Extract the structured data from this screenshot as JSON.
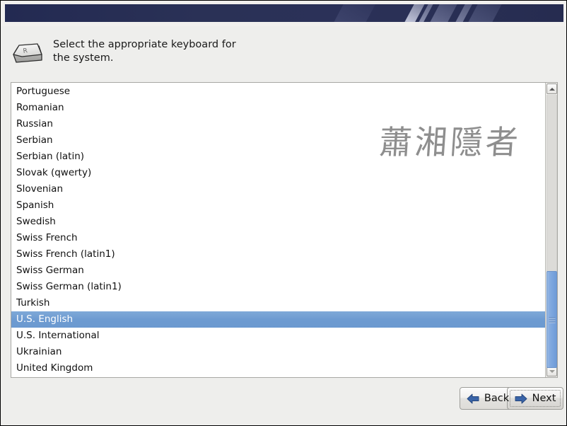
{
  "window": {
    "background_color": "#eeeeec",
    "banner_color": "#2a3156"
  },
  "header": {
    "icon": "keyboard-key-icon",
    "instruction": "Select the appropriate keyboard for\nthe system."
  },
  "keyboard_list": {
    "watermark": "蕭湘隱者",
    "selected": "U.S. English",
    "selection_color": "#6d9bd1",
    "items": [
      {
        "label": "Portuguese",
        "selected": false
      },
      {
        "label": "Romanian",
        "selected": false
      },
      {
        "label": "Russian",
        "selected": false
      },
      {
        "label": "Serbian",
        "selected": false
      },
      {
        "label": "Serbian (latin)",
        "selected": false
      },
      {
        "label": "Slovak (qwerty)",
        "selected": false
      },
      {
        "label": "Slovenian",
        "selected": false
      },
      {
        "label": "Spanish",
        "selected": false
      },
      {
        "label": "Swedish",
        "selected": false
      },
      {
        "label": "Swiss French",
        "selected": false
      },
      {
        "label": "Swiss French (latin1)",
        "selected": false
      },
      {
        "label": "Swiss German",
        "selected": false
      },
      {
        "label": "Swiss German (latin1)",
        "selected": false
      },
      {
        "label": "Turkish",
        "selected": false
      },
      {
        "label": "U.S. English",
        "selected": true
      },
      {
        "label": "U.S. International",
        "selected": false
      },
      {
        "label": "Ukrainian",
        "selected": false
      },
      {
        "label": "United Kingdom",
        "selected": false
      }
    ]
  },
  "scrollbar": {
    "up_icon": "scroll-up-arrow-icon",
    "down_icon": "scroll-down-arrow-icon",
    "thumb_color": "#7ba5dd"
  },
  "footer": {
    "back_label": "Back",
    "back_icon": "arrow-left-icon",
    "next_label": "Next",
    "next_icon": "arrow-right-icon",
    "arrow_color": "#3a64a8",
    "focused_button": "Next"
  }
}
